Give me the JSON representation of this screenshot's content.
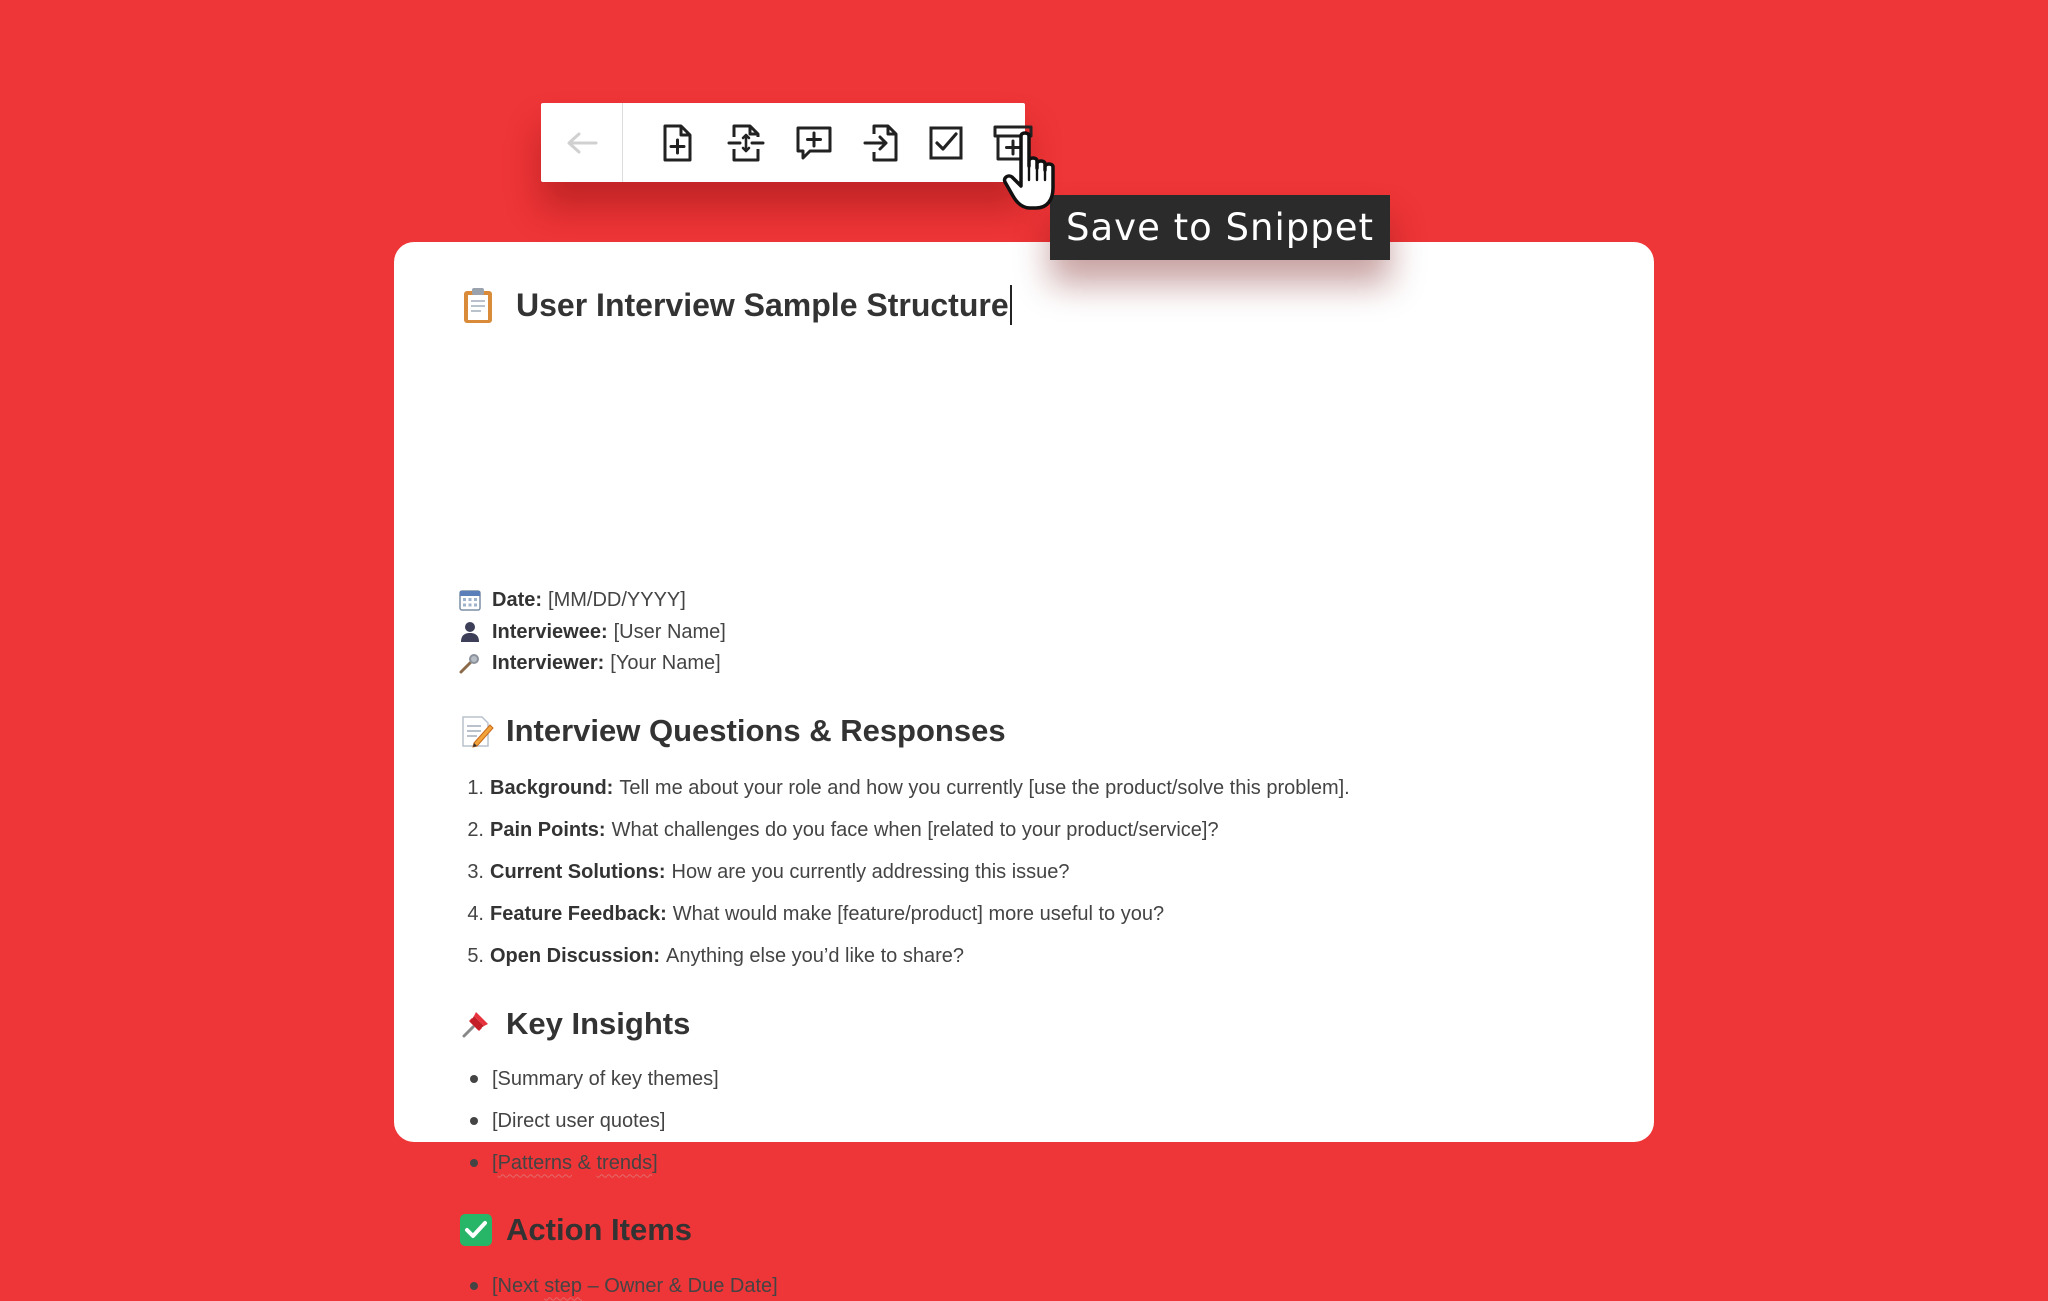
{
  "tooltip": {
    "text": "Save to Snippet"
  },
  "toolbar": {
    "icons": [
      "back-arrow-icon",
      "new-file-icon",
      "replace-file-icon",
      "add-comment-icon",
      "insert-file-icon",
      "checkbox-icon",
      "save-snippet-icon"
    ]
  },
  "colors": {
    "background": "#ee3537",
    "card": "#ffffff",
    "tooltip_bg": "#2b2b2b",
    "text": "#333333",
    "spell_underline": "#e36b6b"
  },
  "doc": {
    "title": "User Interview Sample Structure",
    "meta": [
      {
        "icon": "calendar-icon",
        "label": "Date:",
        "value": "[MM/DD/YYYY]"
      },
      {
        "icon": "person-icon",
        "label": "Interviewee:",
        "value": "[User Name]"
      },
      {
        "icon": "microphone-icon",
        "label": "Interviewer:",
        "value": "[Your Name]"
      }
    ],
    "sections": {
      "questions": {
        "heading": "Interview Questions & Responses",
        "items": [
          {
            "num": "1.",
            "label": "Background:",
            "text": "Tell me about your role and how you currently [use the product/solve this problem]."
          },
          {
            "num": "2.",
            "label": "Pain Points:",
            "text": "What challenges do you face when [related to your product/service]?"
          },
          {
            "num": "3.",
            "label": "Current Solutions:",
            "text": "How are you currently addressing this issue?"
          },
          {
            "num": "4.",
            "label": "Feature Feedback:",
            "text": "What would make [feature/product] more useful to you?"
          },
          {
            "num": "5.",
            "label": "Open Discussion:",
            "text": "Anything else you’d like to share?"
          }
        ]
      },
      "insights": {
        "heading": "Key Insights",
        "items": [
          "[Summary of key themes]",
          "[Direct user quotes]"
        ],
        "patterns": {
          "open": "[",
          "word1": "Patterns",
          "amp": " & ",
          "word2": "trends",
          "close": "]"
        }
      },
      "actions": {
        "heading": "Action Items",
        "item": {
          "pre": "[Next ",
          "word": "step",
          "post": " – Owner & Due Date]"
        }
      }
    }
  }
}
